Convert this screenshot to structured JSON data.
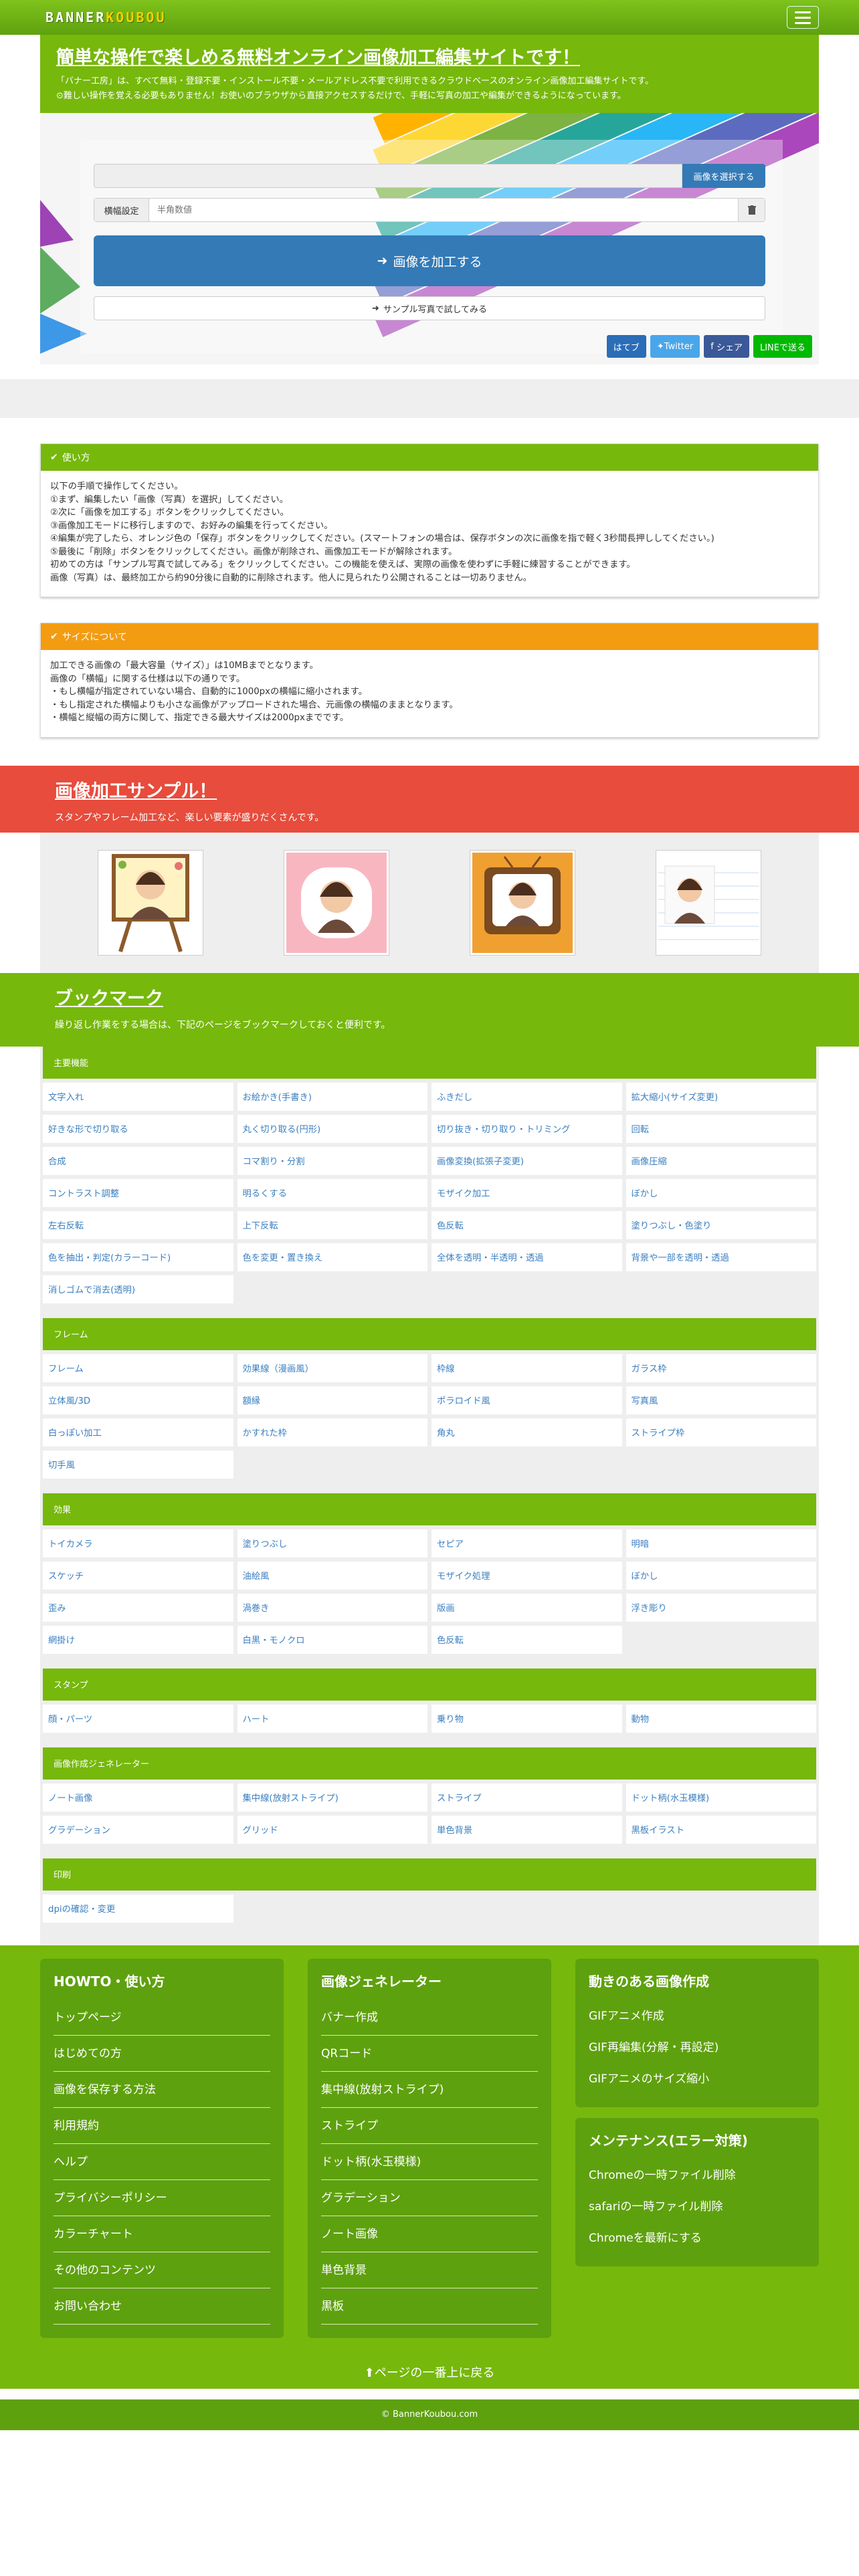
{
  "nav": {
    "logo_a": "BANNER",
    "logo_b": "KOUBOU"
  },
  "hero": {
    "title": "簡単な操作で楽しめる無料オンライン画像加工編集サイトです！",
    "desc1": "「バナー工房」は、すべて無料・登録不要・インストール不要・メールアドレス不要で利用できるクラウドベースのオンライン画像加工編集サイトです。",
    "desc2": "難しい操作を覚える必要もありません！お使いのブラウザから直接アクセスするだけで、手軽に写真の加工や編集ができるようになっています。",
    "select_btn": "画像を選択する",
    "width_label": "横幅設定",
    "width_placeholder": "半角数値",
    "process_btn": "画像を加工する",
    "sample_btn": "サンプル写真で試してみる"
  },
  "share": {
    "hatena": "はてブ",
    "twitter": "Twitter",
    "facebook": "シェア",
    "line": "LINEで送る"
  },
  "howto": {
    "heading": "使い方",
    "lines": [
      "以下の手順で操作してください。",
      "①まず、編集したい「画像（写真）を選択」してください。",
      "②次に「画像を加工する」ボタンをクリックしてください。",
      "③画像加工モードに移行しますので、お好みの編集を行ってください。",
      "④編集が完了したら、オレンジ色の「保存」ボタンをクリックしてください。(スマートフォンの場合は、保存ボタンの次に画像を指で軽く3秒間長押ししてください。)",
      "⑤最後に「削除」ボタンをクリックしてください。画像が削除され、画像加工モードが解除されます。",
      "初めての方は「サンプル写真で試してみる」をクリックしてください。この機能を使えば、実際の画像を使わずに手軽に練習することができます。",
      "画像（写真）は、最終加工から約90分後に自動的に削除されます。他人に見られたり公開されることは一切ありません。"
    ]
  },
  "size": {
    "heading": "サイズについて",
    "lines": [
      "加工できる画像の「最大容量（サイズ）」は10MBまでとなります。",
      "画像の「横幅」に関する仕様は以下の通りです。",
      "・もし横幅が指定されていない場合、自動的に1000pxの横幅に縮小されます。",
      "・もし指定された横幅よりも小さな画像がアップロードされた場合、元画像の横幅のままとなります。",
      "・横幅と縦幅の両方に関して、指定できる最大サイズは2000pxまでです。"
    ]
  },
  "samples": {
    "title": "画像加工サンプル！",
    "subtitle": "スタンプやフレーム加工など、楽しい要素が盛りだくさんです。"
  },
  "bookmark": {
    "title": "ブックマーク",
    "subtitle": "繰り返し作業をする場合は、下記のページをブックマークしておくと便利です。",
    "groups": [
      {
        "name": "主要機能",
        "items": [
          "文字入れ",
          "お絵かき(手書き)",
          "ふきだし",
          "拡大縮小(サイズ変更)",
          "好きな形で切り取る",
          "丸く切り取る(円形)",
          "切り抜き・切り取り・トリミング",
          "回転",
          "合成",
          "コマ割り・分割",
          "画像変換(拡張子変更)",
          "画像圧縮",
          "コントラスト調整",
          "明るくする",
          "モザイク加工",
          "ぼかし",
          "左右反転",
          "上下反転",
          "色反転",
          "塗りつぶし・色塗り",
          "色を抽出・判定(カラーコード)",
          "色を変更・置き換え",
          "全体を透明・半透明・透過",
          "背景や一部を透明・透過",
          "消しゴムで消去(透明)"
        ]
      },
      {
        "name": "フレーム",
        "items": [
          "フレーム",
          "効果線（漫画風）",
          "枠線",
          "ガラス枠",
          "立体風/3D",
          "額縁",
          "ポラロイド風",
          "写真風",
          "白っぽい加工",
          "かすれた枠",
          "角丸",
          "ストライプ枠",
          "切手風"
        ]
      },
      {
        "name": "効果",
        "items": [
          "トイカメラ",
          "塗りつぶし",
          "セピア",
          "明暗",
          "スケッチ",
          "油絵風",
          "モザイク処理",
          "ぼかし",
          "歪み",
          "渦巻き",
          "版画",
          "浮き彫り",
          "網掛け",
          "白黒・モノクロ",
          "色反転"
        ]
      },
      {
        "name": "スタンプ",
        "items": [
          "顔・パーツ",
          "ハート",
          "乗り物",
          "動物"
        ]
      },
      {
        "name": "画像作成ジェネレーター",
        "items": [
          "ノート画像",
          "集中線(放射ストライプ)",
          "ストライプ",
          "ドット柄(水玉模様)",
          "グラデーション",
          "グリッド",
          "単色背景",
          "黒板イラスト"
        ]
      },
      {
        "name": "印刷",
        "items": [
          "dpiの確認・変更"
        ]
      }
    ]
  },
  "footer": {
    "col1": {
      "title": "HOWTO・使い方",
      "links": [
        "トップページ",
        "はじめての方",
        "画像を保存する方法",
        "利用規約",
        "ヘルプ",
        "プライバシーポリシー",
        "カラーチャート",
        "その他のコンテンツ",
        "お問い合わせ"
      ]
    },
    "col2": {
      "title": "画像ジェネレーター",
      "links": [
        "バナー作成",
        "QRコード",
        "集中線(放射ストライプ)",
        "ストライプ",
        "ドット柄(水玉模様)",
        "グラデーション",
        "ノート画像",
        "単色背景",
        "黒板"
      ]
    },
    "col3a": {
      "title": "動きのある画像作成",
      "links": [
        "GIFアニメ作成",
        "GIF再編集(分解・再設定)",
        "GIFアニメのサイズ縮小"
      ]
    },
    "col3b": {
      "title": "メンテナンス(エラー対策)",
      "links": [
        "Chromeの一時ファイル削除",
        "safariの一時ファイル削除",
        "Chromeを最新にする"
      ]
    },
    "gotop": "ページの一番上に戻る",
    "copyright": "© BannerKoubou.com"
  },
  "colors": {
    "green": "#76b80c",
    "dark_green": "#5ea10e",
    "blue": "#337ab7",
    "orange": "#f39c12",
    "red": "#e74c3c"
  }
}
